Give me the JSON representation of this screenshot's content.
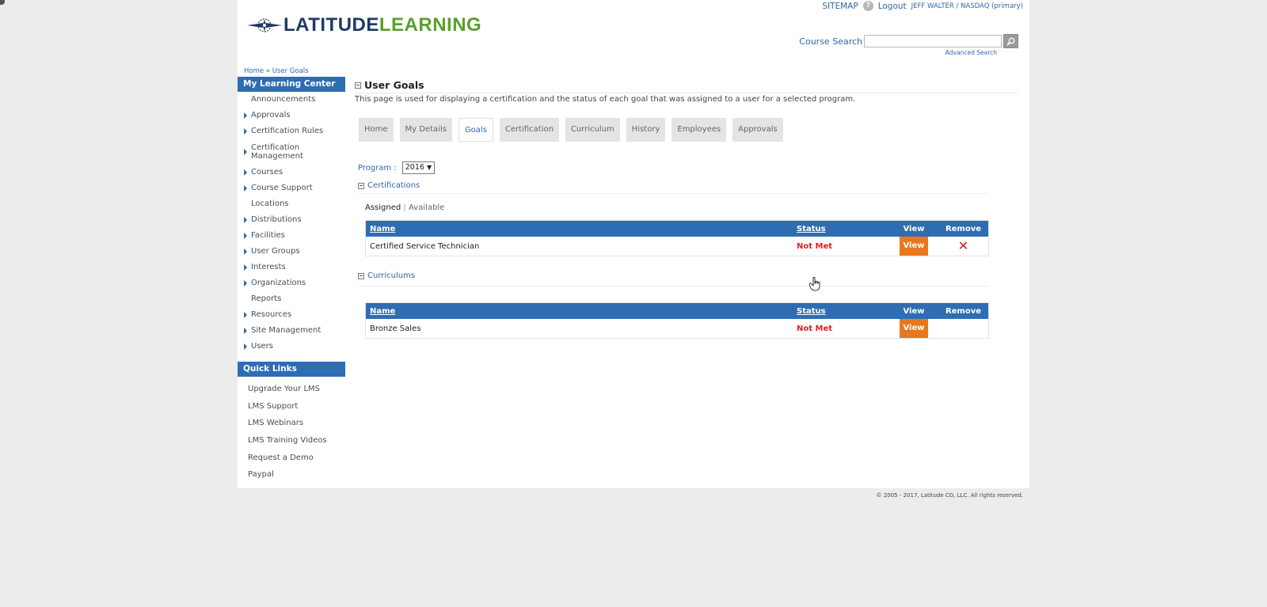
{
  "header": {
    "logo_word1": "LATITUDE",
    "logo_word2": "LEARNING",
    "sitemap": "SITEMAP",
    "help": "?",
    "logout": "Logout",
    "user": "JEFF WALTER / NASDAQ (primary)",
    "search_label": "Course Search",
    "search_placeholder": "",
    "advanced_search": "Advanced Search"
  },
  "breadcrumb": "Home » User Goals",
  "sidebar": {
    "title": "My Learning Center",
    "items": [
      {
        "label": "Announcements",
        "arrow": false
      },
      {
        "label": "Approvals",
        "arrow": true
      },
      {
        "label": "Certification Rules",
        "arrow": true
      },
      {
        "label": "Certification Management",
        "arrow": true
      },
      {
        "label": "Courses",
        "arrow": true
      },
      {
        "label": "Course Support",
        "arrow": true
      },
      {
        "label": "Locations",
        "arrow": false
      },
      {
        "label": "Distributions",
        "arrow": true
      },
      {
        "label": "Facilities",
        "arrow": true
      },
      {
        "label": "User Groups",
        "arrow": true
      },
      {
        "label": "Interests",
        "arrow": true
      },
      {
        "label": "Organizations",
        "arrow": true
      },
      {
        "label": "Reports",
        "arrow": false
      },
      {
        "label": "Resources",
        "arrow": true
      },
      {
        "label": "Site Management",
        "arrow": true
      },
      {
        "label": "Users",
        "arrow": true
      }
    ]
  },
  "quick_links": {
    "title": "Quick Links",
    "items": [
      "Upgrade Your LMS",
      "LMS Support",
      "LMS Webinars",
      "LMS Training Videos",
      "Request a Demo",
      "Paypal"
    ]
  },
  "main": {
    "title": "User Goals",
    "description": "This page is used for displaying a certification and the status of each goal that was assigned to a user for a selected program.",
    "tabs": [
      "Home",
      "My Details",
      "Goals",
      "Certification",
      "Curriculum",
      "History",
      "Employees",
      "Approvals"
    ],
    "active_tab": "Goals",
    "program_label": "Program :",
    "program_value": "2016",
    "certifications": {
      "heading": "Certifications",
      "filter_assigned": "Assigned",
      "filter_sep": "|",
      "filter_available": "Available",
      "columns": {
        "name": "Name",
        "status": "Status",
        "view": "View",
        "remove": "Remove"
      },
      "rows": [
        {
          "name": "Certified Service Technician",
          "status": "Not Met",
          "view": "View",
          "remove": "✕"
        }
      ]
    },
    "curriculums": {
      "heading": "Curriculums",
      "columns": {
        "name": "Name",
        "status": "Status",
        "view": "View",
        "remove": "Remove"
      },
      "rows": [
        {
          "name": "Bronze Sales",
          "status": "Not Met",
          "view": "View"
        }
      ]
    }
  },
  "footer": "© 2005 - 2017, Latitude CG, LLC. All rights reserved.",
  "colors": {
    "accent_blue": "#2f6db3",
    "link_blue": "#2f68a8",
    "view_orange": "#e8781e",
    "status_red": "#e02020",
    "logo_green": "#5aa02c",
    "logo_navy": "#1e3a66"
  },
  "icons": [
    "compass-star-logo-icon",
    "search-icon",
    "help-icon",
    "collapse-icon",
    "expand-arrow-icon",
    "remove-x-icon",
    "hand-cursor-icon"
  ]
}
